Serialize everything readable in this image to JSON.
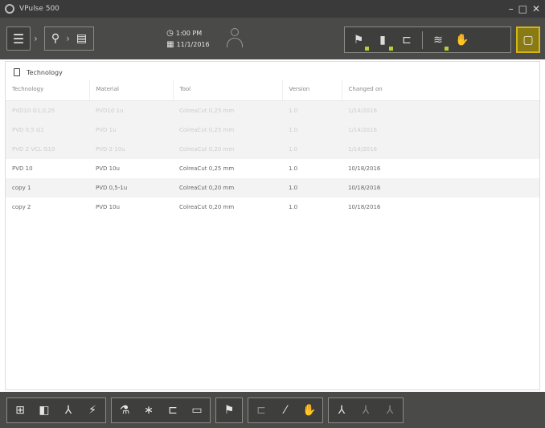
{
  "window": {
    "title": "VPulse 500",
    "controls": [
      "–",
      "□",
      "✕"
    ]
  },
  "toolbar": {
    "time": "1:00 PM",
    "date": "11/1/2016"
  },
  "section": {
    "title": "Technology"
  },
  "table": {
    "columns": [
      "Technology",
      "Material",
      "Tool",
      "Version",
      "Changed on"
    ],
    "rows": [
      {
        "technology": "PVD10 G1,0,25",
        "material": "PVD10 1u",
        "tool": "ColreaCut 0,25 mm",
        "version": "1.0",
        "changed": "1/14/2016",
        "faded": true,
        "shaded": true
      },
      {
        "technology": "PVD 0,5 G1",
        "material": "PVD 1u",
        "tool": "ColreaCut 0,25 mm",
        "version": "1.0",
        "changed": "1/14/2016",
        "faded": true,
        "shaded": true
      },
      {
        "technology": "PVD 2 VCL G10",
        "material": "PVD 2 10u",
        "tool": "ColreaCut 0,20 mm",
        "version": "1.0",
        "changed": "1/14/2016",
        "faded": true,
        "shaded": true
      },
      {
        "technology": "PVD 10",
        "material": "PVD 10u",
        "tool": "ColreaCut 0,25 mm",
        "version": "1.0",
        "changed": "10/18/2016",
        "faded": false,
        "shaded": false
      },
      {
        "technology": "copy 1",
        "material": "PVD 0,5-1u",
        "tool": "ColreaCut 0,20 mm",
        "version": "1.0",
        "changed": "10/18/2016",
        "faded": false,
        "shaded": true
      },
      {
        "technology": "copy 2",
        "material": "PVD 10u",
        "tool": "ColreaCut 0,20 mm",
        "version": "1.0",
        "changed": "10/18/2016",
        "faded": false,
        "shaded": false
      }
    ]
  }
}
